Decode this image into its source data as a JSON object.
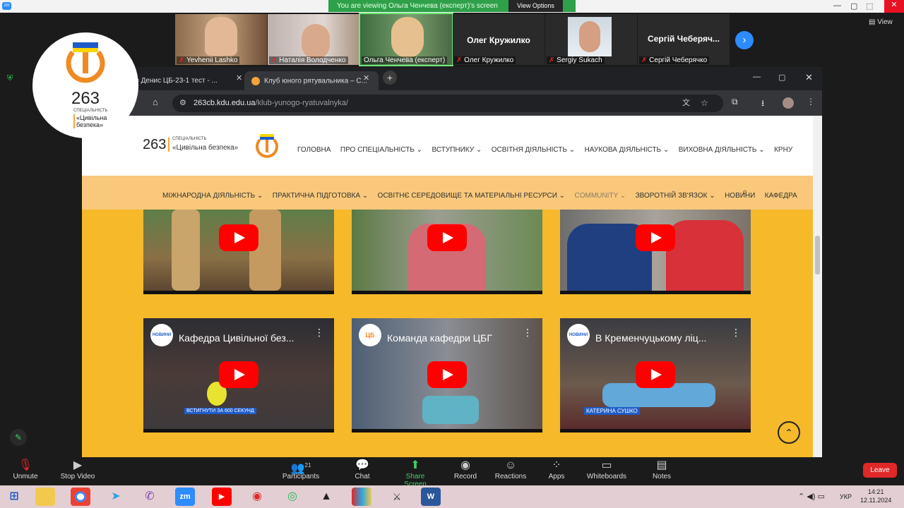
{
  "zoom": {
    "banner_text": "You are viewing Ольга Ченчева (експерт)'s screen",
    "view_options": "View Options",
    "view_label": "View",
    "participants": [
      {
        "name": "Yevhenii Lashko"
      },
      {
        "name": "Наталія Володченко"
      },
      {
        "name": "Ольга Ченчева (експерт)"
      },
      {
        "name": "Олег Кружилко",
        "big": "Олег Кружилко"
      },
      {
        "name": "Sergiy Sukach"
      },
      {
        "name": "Сергій Чеберячко",
        "big": "Сергій Чеберяч..."
      }
    ],
    "toolbar": {
      "unmute": "Unmute",
      "stop_video": "Stop Video",
      "participants": "Participants",
      "participants_count": "21",
      "chat": "Chat",
      "share_screen": "Share Screen",
      "record": "Record",
      "reactions": "Reactions",
      "apps": "Apps",
      "whiteboards": "Whiteboards",
      "notes": "Notes",
      "leave": "Leave"
    }
  },
  "overlay_logo": {
    "number": "263",
    "spec": "СПЕЦІАЛЬНІСТЬ",
    "name_line1": "«Цивільна",
    "name_line2": "безпека»"
  },
  "browser": {
    "tabs": [
      {
        "title": "ов Денис ЦБ-23-1 тест - ..."
      },
      {
        "title": "Клуб юного рятувальника – С..."
      }
    ],
    "url_host": "263cb.kdu.edu.ua",
    "url_path": "/klub-yunogo-ryatuvalnyka/"
  },
  "site": {
    "logo_number": "263",
    "logo_spec": "СПЕЦІАЛЬНІСТЬ",
    "logo_name": "«Цивільна безпека»",
    "nav1": [
      "ГОЛОВНА",
      "ПРО СПЕЦІАЛЬНІСТЬ ⌄",
      "ВСТУПНИКУ ⌄",
      "ОСВІТНЯ ДІЯЛЬНІСТЬ ⌄",
      "НАУКОВА ДІЯЛЬНІСТЬ ⌄",
      "ВИХОВНА ДІЯЛЬНІСТЬ ⌄",
      "КРНУ"
    ],
    "nav2": [
      "МІЖНАРОДНА ДІЯЛЬНІСТЬ ⌄",
      "ПРАКТИЧНА ПІДГОТОВКА ⌄",
      "ОСВІТНЄ СЕРЕДОВИЩЕ ТА МАТЕРІАЛЬНІ РЕСУРСИ ⌄",
      "COMMUNITY ⌄",
      "ЗВОРОТНІЙ ЗВ'ЯЗОК ⌄",
      "НОВИНИ",
      "КАФЕДРА"
    ],
    "videos_row2": [
      {
        "title": "Кафедра Цивільної без...",
        "channel": "НОВИНИ",
        "caption": "ВСТИГНУТИ ЗА 600 СЕКУНД"
      },
      {
        "title": "Команда кафедри ЦБГ",
        "channel": "ЦБ",
        "caption": ""
      },
      {
        "title": "В Кременчуцькому ліц...",
        "channel": "НОВИНИ",
        "caption": "КАТЕРИНА СУШКО"
      }
    ]
  },
  "taskbar": {
    "lang": "УКР",
    "time": "14:21",
    "date": "12.11.2024"
  },
  "colors": {
    "accent": "#f5b92a",
    "zoom_green": "#2fa04a",
    "leave_red": "#e02828",
    "youtube_red": "#ff0000"
  }
}
